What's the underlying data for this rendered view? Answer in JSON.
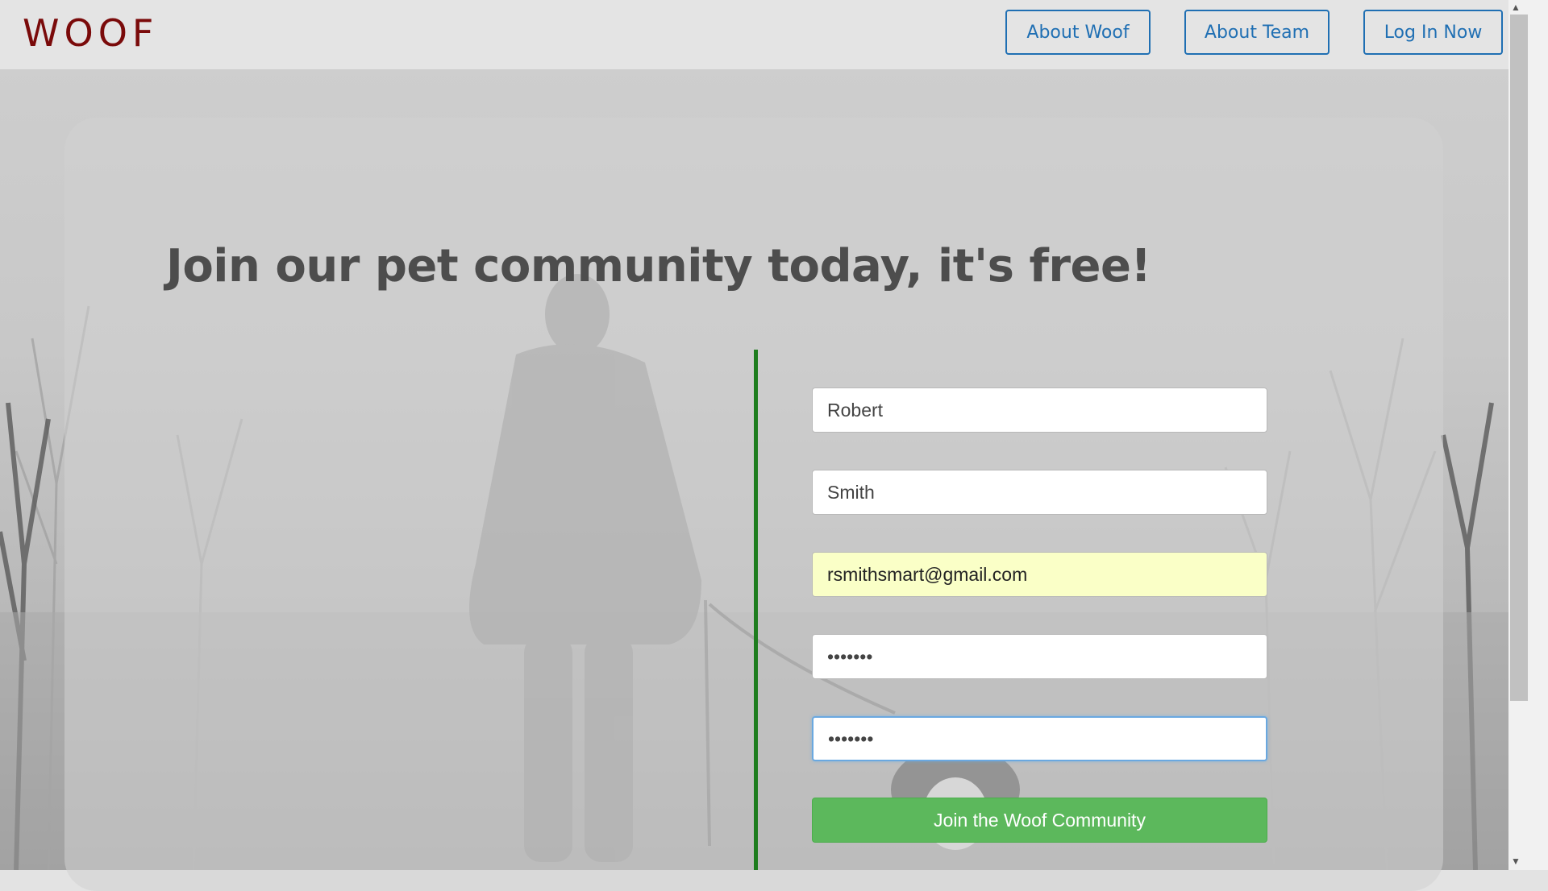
{
  "header": {
    "logo": "WOOF",
    "nav": [
      {
        "label": "About Woof"
      },
      {
        "label": "About Team"
      },
      {
        "label": "Log In Now"
      }
    ]
  },
  "main": {
    "headline": "Join our pet community today, it's free!",
    "form": {
      "first_name": "Robert",
      "last_name": "Smith",
      "email": "rsmithsmart@gmail.com",
      "password": "•••••••",
      "confirm_password": "•••••••",
      "submit_label": "Join the Woof Community"
    }
  },
  "colors": {
    "logo": "#7a0a0a",
    "nav_accent": "#1f6fb3",
    "divider": "#1e7d1e",
    "submit": "#5cb85c",
    "autofill": "#faffc7"
  },
  "icons": {
    "scroll_up": "scroll-up-arrow-icon",
    "scroll_down": "scroll-down-arrow-icon"
  }
}
